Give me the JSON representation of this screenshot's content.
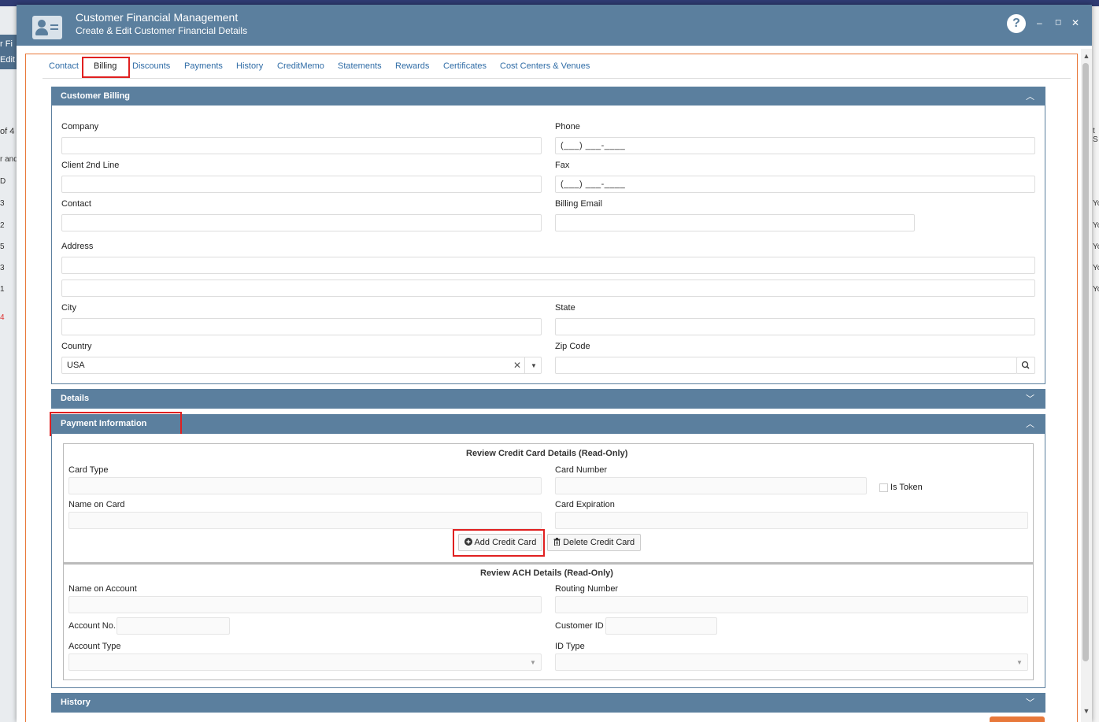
{
  "background": {
    "fragments": [
      "r Fi",
      "Edit",
      "of 4",
      "r and",
      "D",
      "3",
      "2",
      "5",
      "3",
      "1",
      "4",
      "t S",
      "Yo",
      "Yo",
      "Yo",
      "Yo",
      "Yo"
    ]
  },
  "header": {
    "title": "Customer Financial Management",
    "subtitle": "Create & Edit Customer Financial Details",
    "help": "?",
    "minimize": "–",
    "maximize": "◻",
    "close": "✕"
  },
  "tabs": [
    "Contact",
    "Billing",
    "Discounts",
    "Payments",
    "History",
    "CreditMemo",
    "Statements",
    "Rewards",
    "Certificates",
    "Cost Centers & Venues"
  ],
  "billing": {
    "title": "Customer Billing",
    "company_label": "Company",
    "phone_label": "Phone",
    "phone_value": "(___) ___-____",
    "client2_label": "Client 2nd Line",
    "fax_label": "Fax",
    "fax_value": "(___) ___-____",
    "contact_label": "Contact",
    "email_label": "Billing Email",
    "address_label": "Address",
    "city_label": "City",
    "state_label": "State",
    "country_label": "Country",
    "country_value": "USA",
    "zip_label": "Zip Code"
  },
  "details": {
    "title": "Details"
  },
  "payment": {
    "title": "Payment Information",
    "cc_title": "Review Credit Card Details (Read-Only)",
    "card_type_label": "Card Type",
    "card_number_label": "Card Number",
    "is_token_label": "Is Token",
    "name_on_card_label": "Name on Card",
    "card_exp_label": "Card Expiration",
    "add_cc": "Add Credit Card",
    "delete_cc": "Delete Credit Card",
    "ach_title": "Review ACH Details (Read-Only)",
    "name_on_account_label": "Name on Account",
    "routing_label": "Routing Number",
    "account_no_label": "Account No.",
    "customer_id_label": "Customer ID",
    "account_type_label": "Account Type",
    "id_type_label": "ID Type"
  },
  "history": {
    "title": "History"
  },
  "colors": {
    "header": "#5b7f9e",
    "highlight": "#e02020",
    "link": "#2f6ca6",
    "accent": "#e8783a"
  },
  "icons": [
    "contact-card-icon",
    "help-icon",
    "minimize-icon",
    "maximize-icon",
    "close-icon",
    "chevron-up-icon",
    "chevron-down-icon",
    "clear-icon",
    "search-icon",
    "plus-circle-icon",
    "trash-icon"
  ]
}
